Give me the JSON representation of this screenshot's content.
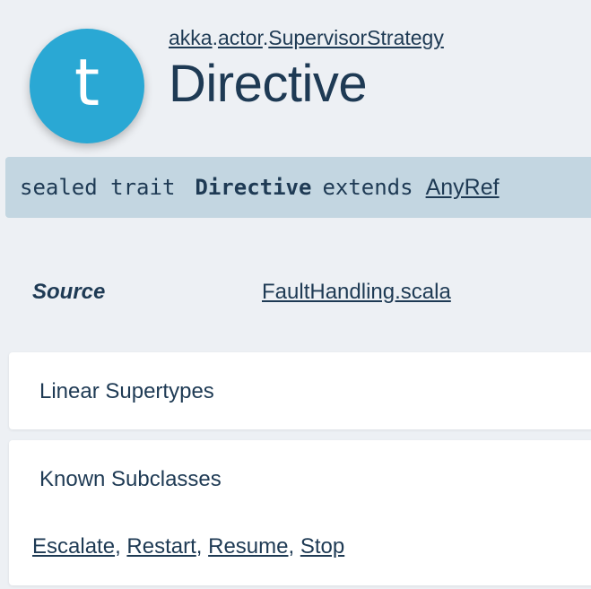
{
  "header": {
    "badge_letter": "t",
    "breadcrumb": {
      "part1": "akka",
      "sep1": ".",
      "part2": "actor",
      "sep2": ".",
      "part3": "SupervisorStrategy"
    },
    "title": "Directive"
  },
  "signature": {
    "modifiers": "sealed trait",
    "name": "Directive",
    "extends_kw": "extends",
    "parent": "AnyRef"
  },
  "source": {
    "label": "Source",
    "file": "FaultHandling.scala"
  },
  "linear_supertypes": {
    "title": "Linear Supertypes"
  },
  "known_subclasses": {
    "title": "Known Subclasses",
    "items": [
      "Escalate",
      "Restart",
      "Resume",
      "Stop"
    ],
    "separator": ", "
  },
  "colors": {
    "badge": "#2aa8d4",
    "text": "#1e3a54",
    "signature_bg": "#c3d6e1",
    "page_bg": "#edf0f4"
  }
}
